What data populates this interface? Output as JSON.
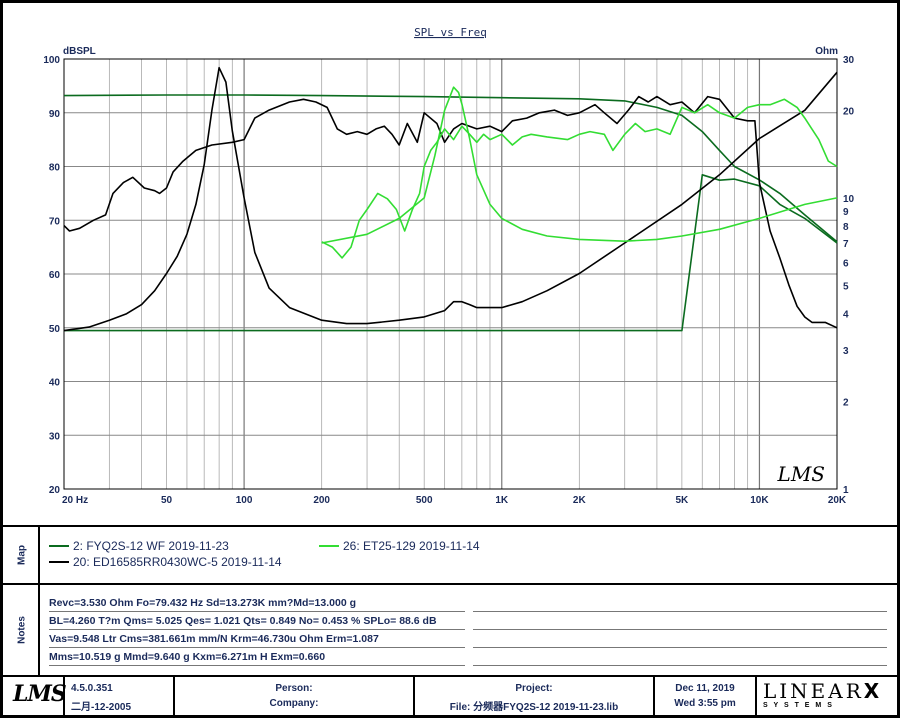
{
  "chart_data": {
    "type": "line",
    "title": "SPL vs Freq",
    "ylabel_left": "dBSPL",
    "ylabel_right": "Ohm",
    "xscale": "log",
    "xlim": [
      20,
      20000
    ],
    "ylim_left": [
      20,
      100
    ],
    "ylim_right": [
      1,
      30
    ],
    "yscale_right": "log",
    "grid": true,
    "watermark": "LMS",
    "x_ticks": [
      {
        "value": 20,
        "label": "20  Hz"
      },
      {
        "value": 50,
        "label": "50"
      },
      {
        "value": 100,
        "label": "100"
      },
      {
        "value": 200,
        "label": "200"
      },
      {
        "value": 500,
        "label": "500"
      },
      {
        "value": 1000,
        "label": "1K"
      },
      {
        "value": 2000,
        "label": "2K"
      },
      {
        "value": 5000,
        "label": "5K"
      },
      {
        "value": 10000,
        "label": "10K"
      },
      {
        "value": 20000,
        "label": "20K"
      }
    ],
    "y_ticks_left": [
      100,
      90,
      80,
      70,
      60,
      50,
      40,
      30,
      20
    ],
    "y_ticks_right": [
      {
        "value": 30,
        "label": "30"
      },
      {
        "value": 20,
        "label": "20"
      },
      {
        "value": 10,
        "label": "10"
      },
      {
        "value": 9,
        "label": "9"
      },
      {
        "value": 8,
        "label": "8"
      },
      {
        "value": 7,
        "label": "7"
      },
      {
        "value": 6,
        "label": "6"
      },
      {
        "value": 5,
        "label": "5"
      },
      {
        "value": 4,
        "label": "4"
      },
      {
        "value": 3,
        "label": "3"
      },
      {
        "value": 2,
        "label": "2"
      },
      {
        "value": 1,
        "label": "1"
      }
    ],
    "series": [
      {
        "name": "2: FYQ2S-12  WF 2019-11-23",
        "kind": "spl",
        "axis": "left",
        "color": "#0b6b1f",
        "points": [
          [
            20,
            93.2
          ],
          [
            50,
            93.3
          ],
          [
            100,
            93.3
          ],
          [
            200,
            93.2
          ],
          [
            500,
            93
          ],
          [
            1000,
            92.8
          ],
          [
            2000,
            92.6
          ],
          [
            3000,
            92.2
          ],
          [
            4000,
            91
          ],
          [
            5000,
            89.5
          ],
          [
            6000,
            86.5
          ],
          [
            7000,
            83
          ],
          [
            8000,
            80
          ],
          [
            10000,
            77.5
          ],
          [
            12000,
            75
          ],
          [
            15000,
            71
          ],
          [
            20000,
            66
          ]
        ]
      },
      {
        "name": "2: FYQ2S-12  WF 2019-11-23",
        "kind": "impedance",
        "axis": "right",
        "color": "#0b6b1f",
        "points": [
          [
            20,
            3.5
          ],
          [
            30,
            3.5
          ],
          [
            50,
            3.5
          ],
          [
            80,
            3.5
          ],
          [
            100,
            3.5
          ],
          [
            150,
            3.5
          ],
          [
            200,
            3.5
          ],
          [
            300,
            3.5
          ],
          [
            500,
            3.5
          ],
          [
            800,
            3.5
          ],
          [
            1000,
            3.5
          ],
          [
            2000,
            3.5
          ],
          [
            3000,
            3.5
          ],
          [
            5000,
            3.5
          ],
          [
            6000,
            12
          ],
          [
            7000,
            11.5
          ],
          [
            8000,
            11.6
          ],
          [
            10000,
            11
          ],
          [
            12000,
            9.5
          ],
          [
            15000,
            8.5
          ],
          [
            20000,
            7
          ]
        ]
      },
      {
        "name": "20: ED16585RR0430WC-5   2019-11-14",
        "kind": "spl",
        "axis": "left",
        "color": "#000000",
        "points": [
          [
            20,
            69
          ],
          [
            21,
            68
          ],
          [
            23,
            68.5
          ],
          [
            26,
            70
          ],
          [
            29,
            71
          ],
          [
            31,
            75
          ],
          [
            34,
            77
          ],
          [
            37,
            78
          ],
          [
            41,
            76
          ],
          [
            45,
            75.5
          ],
          [
            47,
            75
          ],
          [
            50,
            76
          ],
          [
            53,
            79
          ],
          [
            58,
            81
          ],
          [
            65,
            83
          ],
          [
            75,
            84
          ],
          [
            90,
            84.5
          ],
          [
            100,
            85
          ],
          [
            110,
            89
          ],
          [
            125,
            90.5
          ],
          [
            150,
            92
          ],
          [
            170,
            92.5
          ],
          [
            190,
            92
          ],
          [
            210,
            91
          ],
          [
            230,
            87
          ],
          [
            250,
            86
          ],
          [
            275,
            86.5
          ],
          [
            300,
            86
          ],
          [
            325,
            87
          ],
          [
            350,
            87.5
          ],
          [
            375,
            86
          ],
          [
            400,
            84
          ],
          [
            430,
            88
          ],
          [
            470,
            84.5
          ],
          [
            500,
            90
          ],
          [
            560,
            88
          ],
          [
            600,
            84.5
          ],
          [
            650,
            87
          ],
          [
            700,
            88
          ],
          [
            800,
            87
          ],
          [
            900,
            87.5
          ],
          [
            1000,
            86.5
          ],
          [
            1100,
            88.5
          ],
          [
            1250,
            89
          ],
          [
            1400,
            90
          ],
          [
            1600,
            90.5
          ],
          [
            1800,
            89.5
          ],
          [
            2000,
            90
          ],
          [
            2300,
            91.5
          ],
          [
            2500,
            90
          ],
          [
            2800,
            88
          ],
          [
            3100,
            90.5
          ],
          [
            3400,
            93
          ],
          [
            3700,
            92
          ],
          [
            4000,
            93
          ],
          [
            4500,
            91.5
          ],
          [
            5000,
            92
          ],
          [
            5600,
            90
          ],
          [
            6300,
            93
          ],
          [
            7000,
            92.5
          ],
          [
            8000,
            89
          ],
          [
            9000,
            88.5
          ],
          [
            9600,
            88.5
          ],
          [
            10000,
            77
          ],
          [
            11000,
            68
          ],
          [
            12000,
            63
          ],
          [
            13000,
            58
          ],
          [
            14000,
            54
          ],
          [
            15000,
            52
          ],
          [
            16000,
            51
          ],
          [
            18000,
            51
          ],
          [
            20000,
            50
          ]
        ]
      },
      {
        "name": "20: ED16585RR0430WC-5   2019-11-14",
        "kind": "impedance",
        "axis": "right",
        "color": "#000000",
        "points": [
          [
            20,
            3.5
          ],
          [
            25,
            3.6
          ],
          [
            30,
            3.8
          ],
          [
            35,
            4.0
          ],
          [
            40,
            4.3
          ],
          [
            45,
            4.8
          ],
          [
            50,
            5.5
          ],
          [
            55,
            6.3
          ],
          [
            60,
            7.5
          ],
          [
            65,
            9.5
          ],
          [
            70,
            13
          ],
          [
            75,
            20
          ],
          [
            80,
            28
          ],
          [
            85,
            25
          ],
          [
            90,
            17
          ],
          [
            100,
            10
          ],
          [
            110,
            6.5
          ],
          [
            125,
            4.9
          ],
          [
            150,
            4.2
          ],
          [
            200,
            3.8
          ],
          [
            250,
            3.7
          ],
          [
            300,
            3.7
          ],
          [
            400,
            3.8
          ],
          [
            500,
            3.9
          ],
          [
            600,
            4.1
          ],
          [
            650,
            4.4
          ],
          [
            700,
            4.4
          ],
          [
            750,
            4.3
          ],
          [
            800,
            4.2
          ],
          [
            900,
            4.2
          ],
          [
            1000,
            4.2
          ],
          [
            1200,
            4.4
          ],
          [
            1500,
            4.8
          ],
          [
            2000,
            5.5
          ],
          [
            3000,
            7
          ],
          [
            5000,
            9.5
          ],
          [
            7000,
            12
          ],
          [
            10000,
            16
          ],
          [
            15000,
            20
          ],
          [
            20000,
            27
          ]
        ]
      },
      {
        "name": "26: ET25-129  2019-11-14",
        "kind": "spl",
        "axis": "left",
        "color": "#33dd33",
        "points": [
          [
            200,
            66
          ],
          [
            220,
            65
          ],
          [
            240,
            63
          ],
          [
            260,
            65
          ],
          [
            280,
            70
          ],
          [
            300,
            72
          ],
          [
            330,
            75
          ],
          [
            360,
            74
          ],
          [
            390,
            72
          ],
          [
            420,
            68
          ],
          [
            450,
            72
          ],
          [
            480,
            75
          ],
          [
            500,
            80
          ],
          [
            530,
            83
          ],
          [
            560,
            84.5
          ],
          [
            600,
            87
          ],
          [
            650,
            85
          ],
          [
            700,
            87.5
          ],
          [
            750,
            86
          ],
          [
            800,
            84.5
          ],
          [
            850,
            86
          ],
          [
            900,
            85
          ],
          [
            1000,
            86
          ],
          [
            1100,
            84
          ],
          [
            1200,
            85.5
          ],
          [
            1300,
            86
          ],
          [
            1500,
            85.5
          ],
          [
            1800,
            85
          ],
          [
            2000,
            86
          ],
          [
            2200,
            86.5
          ],
          [
            2500,
            86
          ],
          [
            2700,
            83
          ],
          [
            3000,
            86
          ],
          [
            3300,
            88
          ],
          [
            3600,
            86.5
          ],
          [
            4000,
            87
          ],
          [
            4500,
            86
          ],
          [
            5000,
            91
          ],
          [
            5600,
            90
          ],
          [
            6300,
            91.5
          ],
          [
            7000,
            90
          ],
          [
            8000,
            89
          ],
          [
            9000,
            91
          ],
          [
            10000,
            91.5
          ],
          [
            11000,
            91.5
          ],
          [
            12500,
            92.5
          ],
          [
            14000,
            91
          ],
          [
            15000,
            89
          ],
          [
            17000,
            85
          ],
          [
            18500,
            81
          ],
          [
            20000,
            80
          ]
        ]
      },
      {
        "name": "26: ET25-129  2019-11-14",
        "kind": "impedance",
        "axis": "right",
        "color": "#33dd33",
        "points": [
          [
            200,
            7
          ],
          [
            300,
            7.5
          ],
          [
            400,
            8.5
          ],
          [
            500,
            10
          ],
          [
            550,
            14
          ],
          [
            600,
            20
          ],
          [
            650,
            24
          ],
          [
            680,
            23
          ],
          [
            700,
            21
          ],
          [
            750,
            16
          ],
          [
            800,
            12
          ],
          [
            900,
            9.5
          ],
          [
            1000,
            8.5
          ],
          [
            1200,
            7.8
          ],
          [
            1500,
            7.4
          ],
          [
            2000,
            7.2
          ],
          [
            3000,
            7.1
          ],
          [
            4000,
            7.2
          ],
          [
            5000,
            7.4
          ],
          [
            7000,
            7.8
          ],
          [
            10000,
            8.5
          ],
          [
            15000,
            9.5
          ],
          [
            20000,
            10
          ]
        ]
      }
    ]
  },
  "legend": [
    {
      "label": "2: FYQ2S-12  WF 2019-11-23",
      "color": "#0b6b1f"
    },
    {
      "label": "20: ED16585RR0430WC-5   2019-11-14",
      "color": "#000000"
    },
    {
      "label": "26: ET25-129  2019-11-14",
      "color": "#33dd33"
    }
  ],
  "sections": {
    "map": "Map",
    "notes": "Notes"
  },
  "notes": [
    "Revc=3.530 Ohm  Fo=79.432 Hz  Sd=13.273K mm?Md=13.000 g",
    "BL=4.260 T?m  Qms= 5.025  Qes= 1.021  Qts= 0.849  No= 0.453 %  SPLo= 88.6 dB",
    "Vas=9.548 Ltr  Cms=381.661m mm/N  Krm=46.730u Ohm  Erm=1.087",
    "Mms=10.519 g  Mmd=9.640 g  Kxm=6.271m H  Exm=0.660"
  ],
  "footer": {
    "logo": "LMS",
    "version": "4.5.0.351",
    "version_date": "二月-12-2005",
    "person_label": "Person:",
    "company_label": "Company:",
    "project_label": "Project:",
    "file_text": "File: 分频器FYQ2S-12  2019-11-23.lib",
    "date": "Dec 11, 2019",
    "time": "Wed  3:55 pm",
    "brand": "LINEAR",
    "brand_x": "X",
    "brand_sub": "S Y S T E M S"
  }
}
